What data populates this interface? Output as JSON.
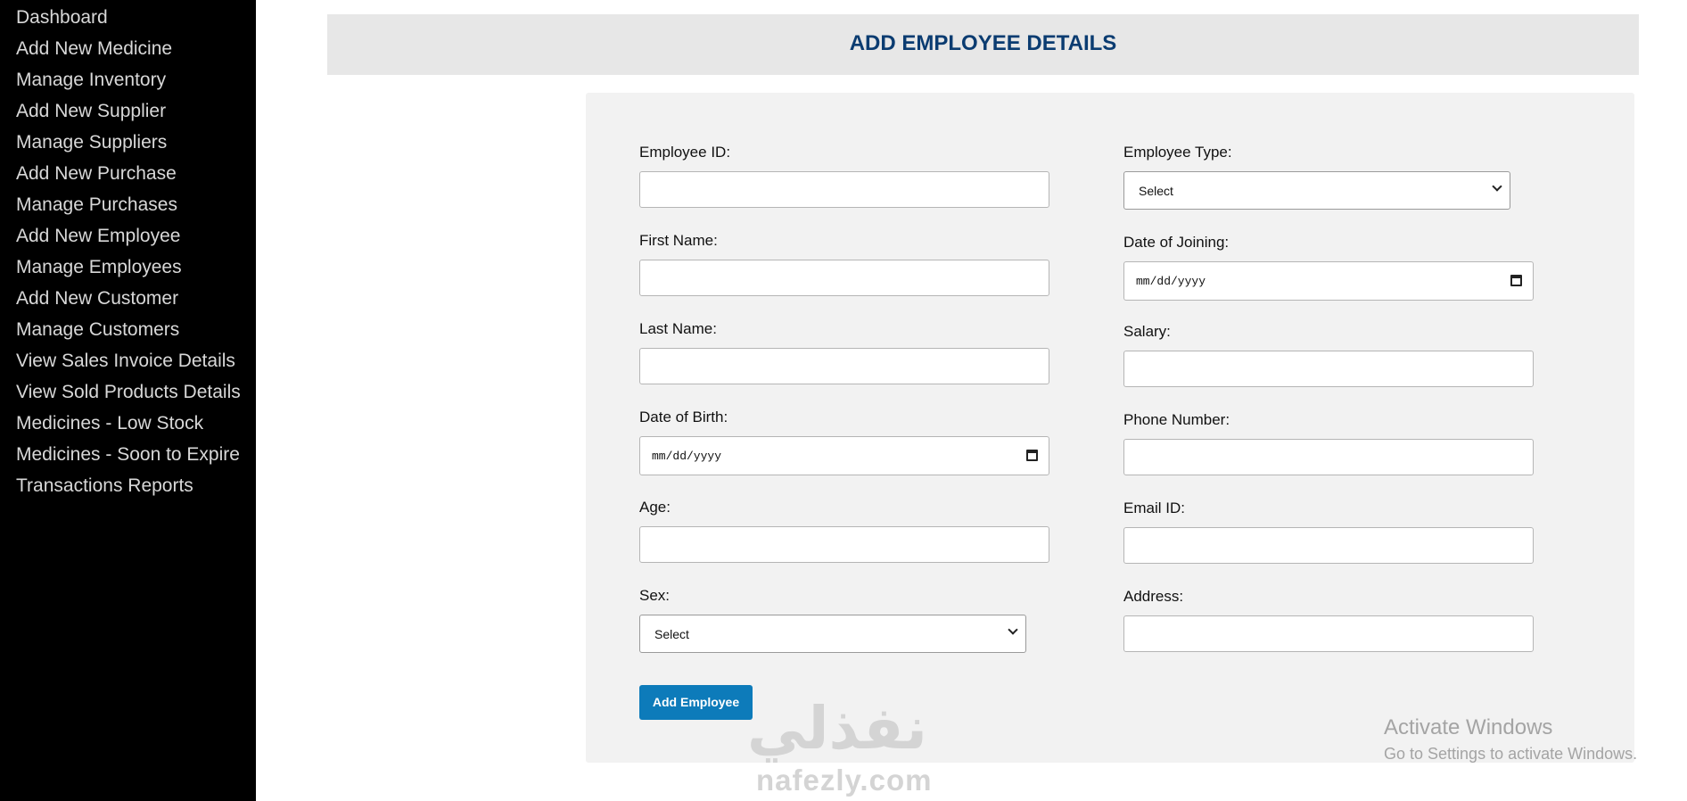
{
  "sidebar": {
    "items": [
      {
        "label": "Dashboard"
      },
      {
        "label": "Add New Medicine"
      },
      {
        "label": "Manage Inventory"
      },
      {
        "label": "Add New Supplier"
      },
      {
        "label": "Manage Suppliers"
      },
      {
        "label": "Add New Purchase"
      },
      {
        "label": "Manage Purchases"
      },
      {
        "label": "Add New Employee"
      },
      {
        "label": "Manage Employees"
      },
      {
        "label": "Add New Customer"
      },
      {
        "label": "Manage Customers"
      },
      {
        "label": "View Sales Invoice Details"
      },
      {
        "label": "View Sold Products Details"
      },
      {
        "label": "Medicines - Low Stock"
      },
      {
        "label": "Medicines - Soon to Expire"
      },
      {
        "label": "Transactions Reports"
      }
    ]
  },
  "header": {
    "title": "ADD EMPLOYEE DETAILS"
  },
  "form": {
    "employee_id": {
      "label": "Employee ID:",
      "value": ""
    },
    "first_name": {
      "label": "First Name:",
      "value": ""
    },
    "last_name": {
      "label": "Last Name:",
      "value": ""
    },
    "dob": {
      "label": "Date of Birth:",
      "placeholder": "mm/dd/yyyy"
    },
    "age": {
      "label": "Age:",
      "value": ""
    },
    "sex": {
      "label": "Sex:",
      "selected": "Select"
    },
    "employee_type": {
      "label": "Employee Type:",
      "selected": "Select"
    },
    "date_of_joining": {
      "label": "Date of Joining:",
      "placeholder": "mm/dd/yyyy"
    },
    "salary": {
      "label": "Salary:",
      "value": ""
    },
    "phone": {
      "label": "Phone Number:",
      "value": ""
    },
    "email": {
      "label": "Email ID:",
      "value": ""
    },
    "address": {
      "label": "Address:",
      "value": ""
    },
    "submit_label": "Add Employee"
  },
  "watermark": {
    "arabic": "نفذلي",
    "latin": "nafezly.com"
  },
  "activation": {
    "title": "Activate Windows",
    "subtitle": "Go to Settings to activate Windows."
  },
  "colors": {
    "sidebar_bg": "#000000",
    "title": "#0b3c71",
    "button": "#0d7bba",
    "panel": "#f2f2f2"
  }
}
